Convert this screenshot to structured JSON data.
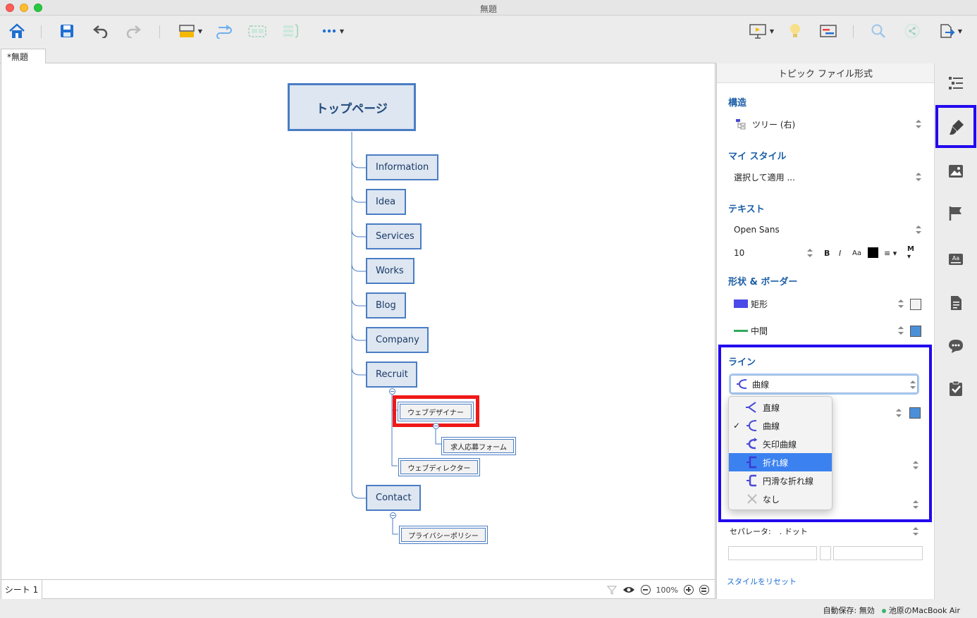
{
  "window": {
    "title": "無題"
  },
  "tabs": {
    "document": "*無題",
    "sheet": "シート 1"
  },
  "mindmap": {
    "root": "トップページ",
    "topics": [
      "Information",
      "Idea",
      "Services",
      "Works",
      "Blog",
      "Company",
      "Recruit",
      "Contact"
    ],
    "recruit_children": [
      "ウェブデザイナー",
      "ウェブディレクター"
    ],
    "designer_child": "求人応募フォーム",
    "contact_child": "プライバシーポリシー"
  },
  "zoom": {
    "level": "100%"
  },
  "status": {
    "autosave": "自動保存: 無効",
    "device": "池原のMacBook Air"
  },
  "panel": {
    "title": "トピック ファイル形式",
    "structure": {
      "heading": "構造",
      "value": "ツリー (右)"
    },
    "mystyle": {
      "heading": "マイ スタイル",
      "value": "選択して適用 ..."
    },
    "text": {
      "heading": "テキスト",
      "font": "Open Sans",
      "size": "10",
      "bold": "B",
      "italic": "I",
      "case": "Aa",
      "more": "M"
    },
    "shape": {
      "heading": "形状 & ボーダー",
      "shape_value": "矩形",
      "border_value": "中間"
    },
    "line": {
      "heading": "ライン",
      "value": "曲線",
      "options": [
        "直線",
        "曲線",
        "矢印曲線",
        "折れ線",
        "円滑な折れ線",
        "なし"
      ]
    },
    "separator": {
      "label": "セパレータ:",
      "value": ". ドット"
    },
    "reset": "スタイルをリセット"
  },
  "colors": {
    "accent": "#2208ee",
    "highlight": "#f01818",
    "node_border": "#4a7dc4",
    "menu_selected": "#3b82f0"
  }
}
